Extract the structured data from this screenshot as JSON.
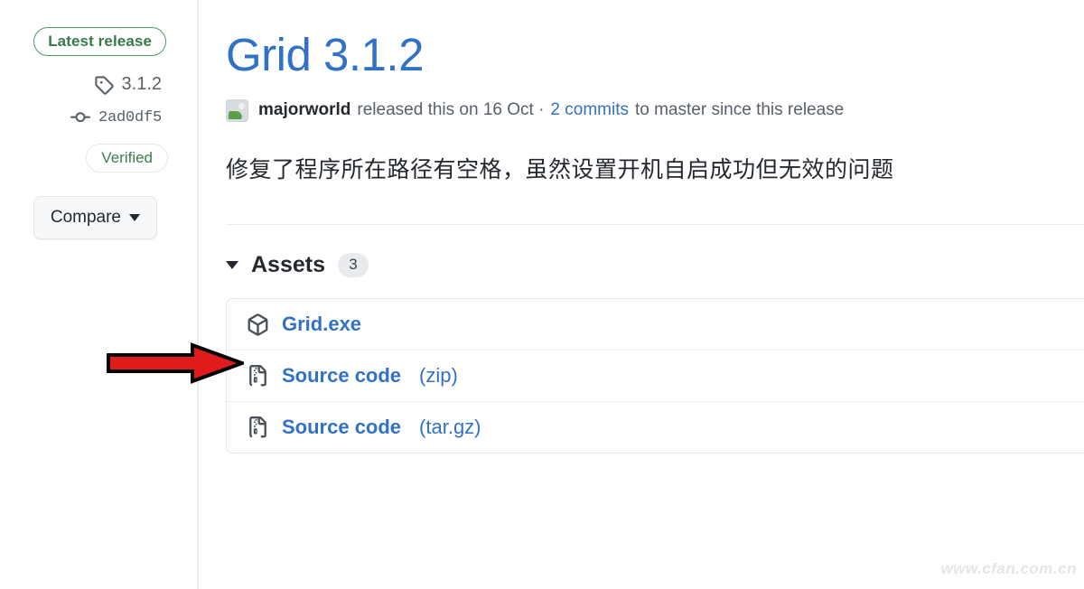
{
  "sidebar": {
    "latest_badge": "Latest release",
    "tag_icon": "tag-icon",
    "tag": "3.1.2",
    "commit_icon": "commit-icon",
    "commit": "2ad0df5",
    "verified_badge": "Verified",
    "compare_button": "Compare",
    "compare_caret_icon": "chevron-down-icon"
  },
  "main": {
    "title": "Grid 3.1.2",
    "byline": {
      "avatar_icon": "avatar",
      "author": "majorworld",
      "released_text": "released this on 16 Oct ·",
      "commits_link": "2 commits",
      "trailing_text": "to master since this release"
    },
    "body": "修复了程序所在路径有空格，虽然设置开机自启成功但无效的问题",
    "assets": {
      "caret_icon": "caret-down-icon",
      "label": "Assets",
      "count": "3",
      "rows": [
        {
          "icon": "package-icon",
          "name": "Grid.exe",
          "suffix": ""
        },
        {
          "icon": "file-zip-icon",
          "name": "Source code",
          "suffix": "(zip)"
        },
        {
          "icon": "file-zip-icon",
          "name": "Source code",
          "suffix": "(tar.gz)"
        }
      ]
    }
  },
  "annotation": {
    "arrow_icon": "red-arrow-pointer",
    "arrow_color": "#e01b1b",
    "arrow_outline": "#000000"
  },
  "watermark": "www.cfan.com.cn",
  "colors": {
    "link_blue": "#3272c6",
    "green": "#377a4a",
    "muted": "#57606a",
    "border": "#e6e8ea"
  }
}
